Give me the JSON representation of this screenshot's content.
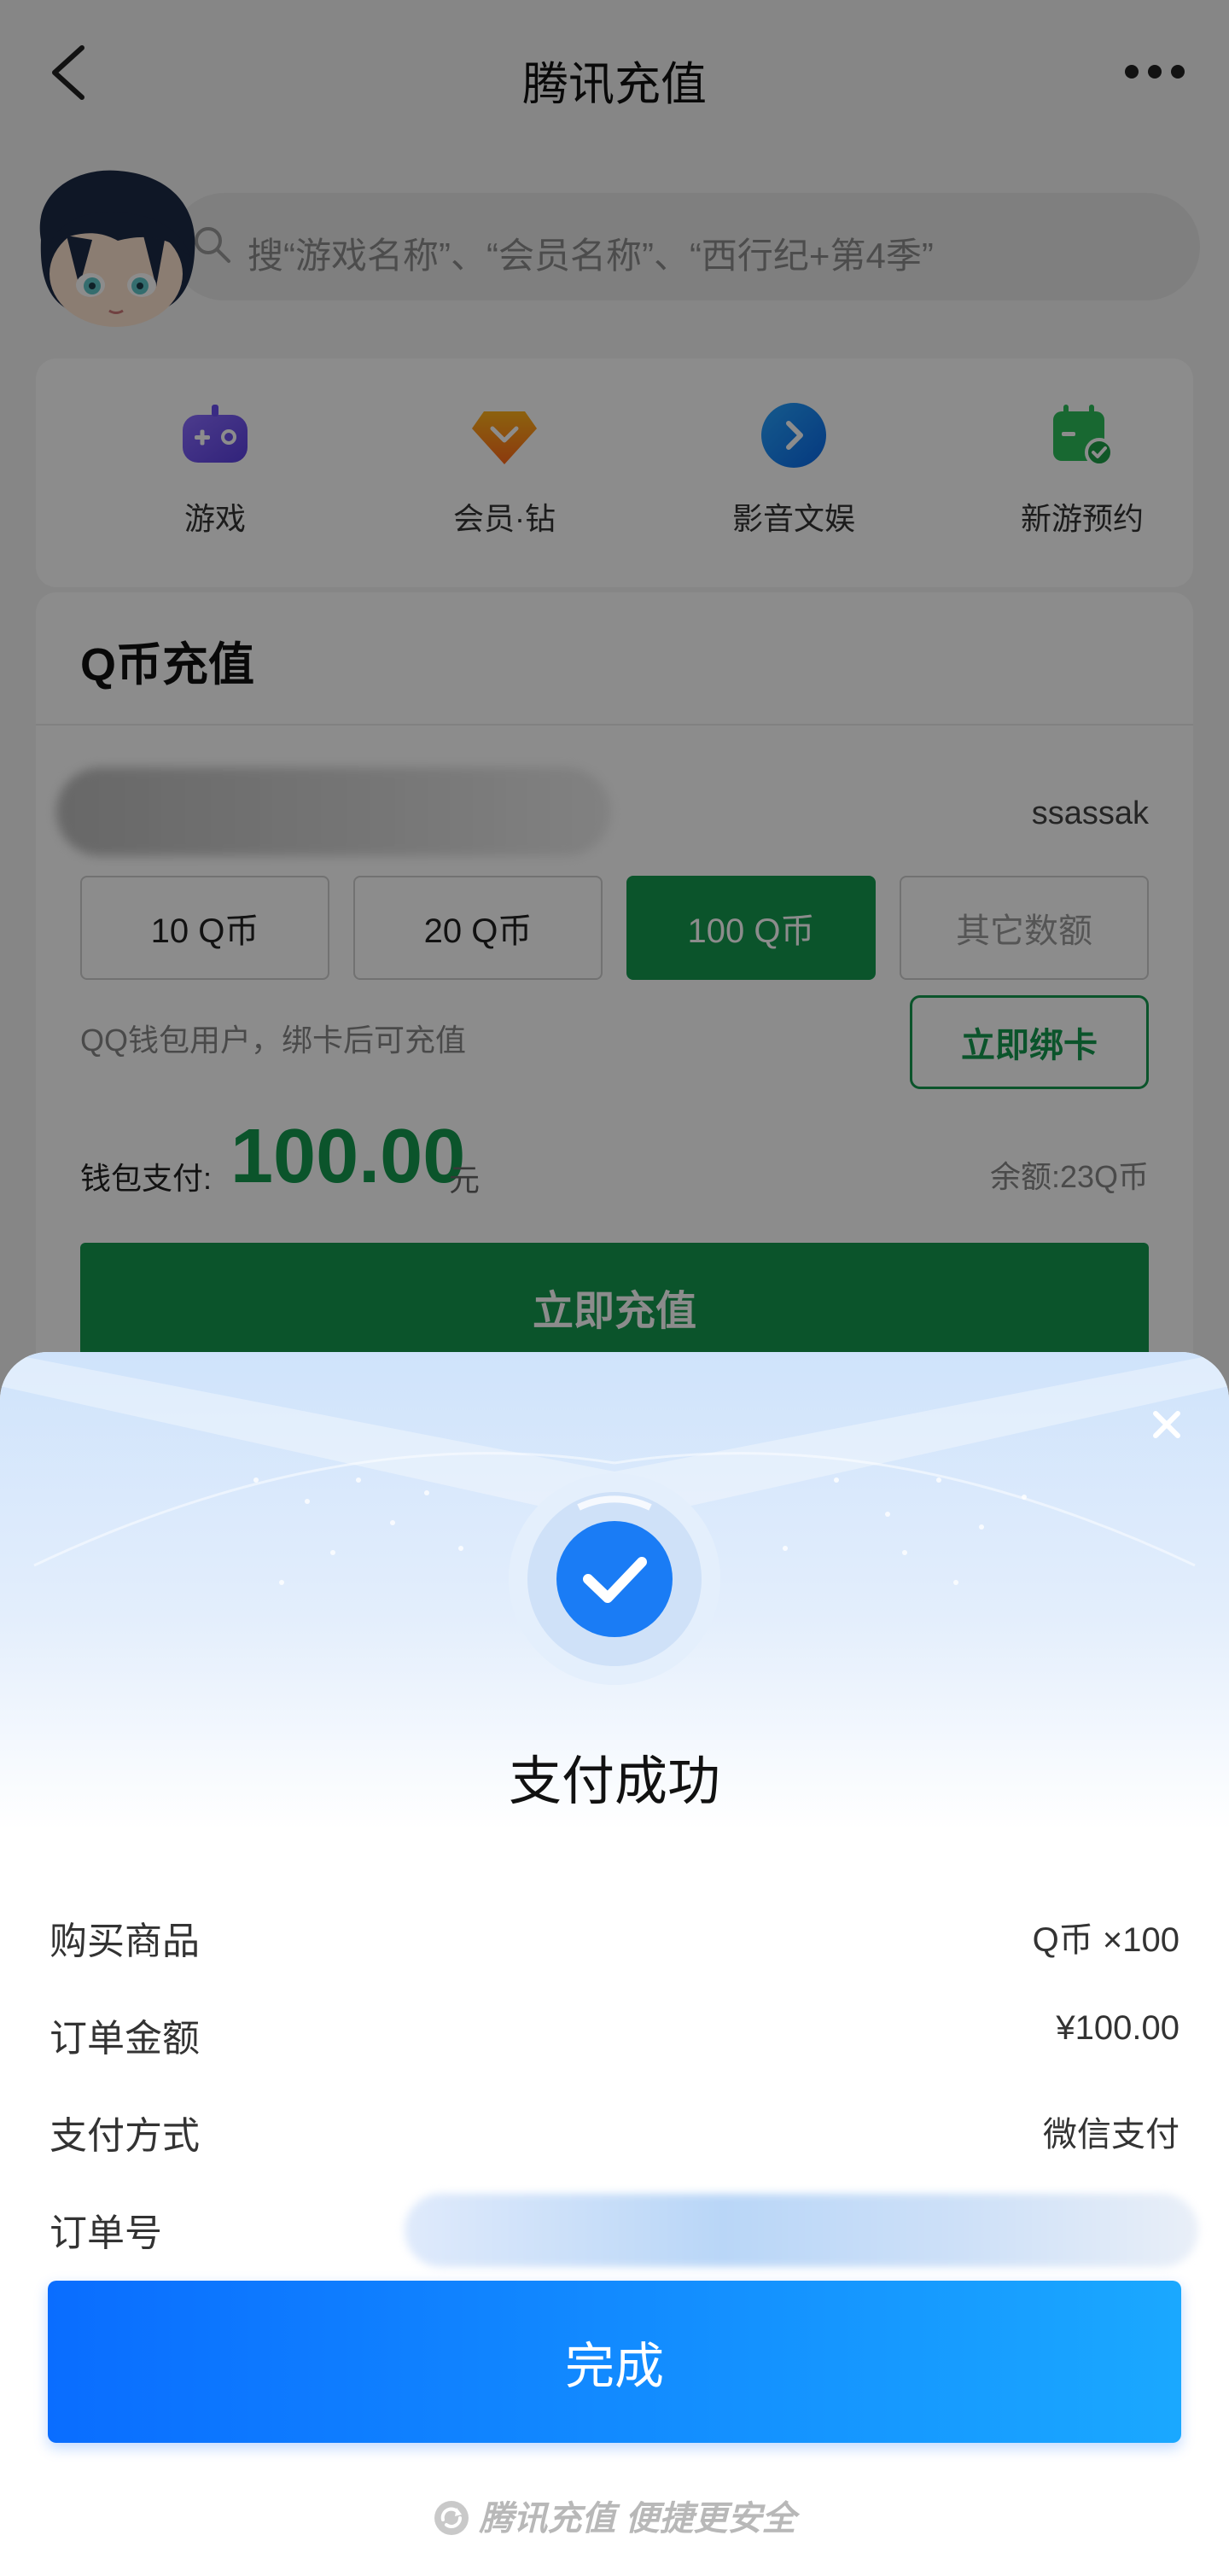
{
  "header": {
    "title": "腾讯充值"
  },
  "search": {
    "placeholder": "搜“游戏名称”、“会员名称”、“西行纪+第4季”"
  },
  "categories": [
    {
      "label": "游戏",
      "icon": "gamepad-icon"
    },
    {
      "label": "会员·钻",
      "icon": "diamond-icon"
    },
    {
      "label": "影音文娱",
      "icon": "play-icon"
    },
    {
      "label": "新游预约",
      "icon": "calendar-check-icon"
    }
  ],
  "qcoin": {
    "title": "Q币充值",
    "account_name": "ssassak",
    "amounts": [
      {
        "label": "10 Q币",
        "state": "normal"
      },
      {
        "label": "20 Q币",
        "state": "normal"
      },
      {
        "label": "100 Q币",
        "state": "selected"
      },
      {
        "label": "其它数额",
        "state": "disabled"
      }
    ],
    "bind_hint": "QQ钱包用户，绑卡后可充值",
    "bind_button": "立即绑卡",
    "pay_label": "钱包支付:",
    "pay_value": "100.00",
    "pay_unit": "元",
    "balance": "余额:23Q币",
    "recharge_button": "立即充值"
  },
  "sheet": {
    "title": "支付成功",
    "rows": [
      {
        "key": "购买商品",
        "value": "Q币 ×100"
      },
      {
        "key": "订单金额",
        "value": "¥100.00"
      },
      {
        "key": "支付方式",
        "value": "微信支付"
      },
      {
        "key": "订单号",
        "value": ""
      }
    ],
    "done_button": "完成",
    "footer": "腾讯充值 便捷更安全"
  },
  "colors": {
    "brand_green": "#149a4f",
    "accent_blue": "#0a6dff",
    "success_blue": "#1a7cf5"
  }
}
